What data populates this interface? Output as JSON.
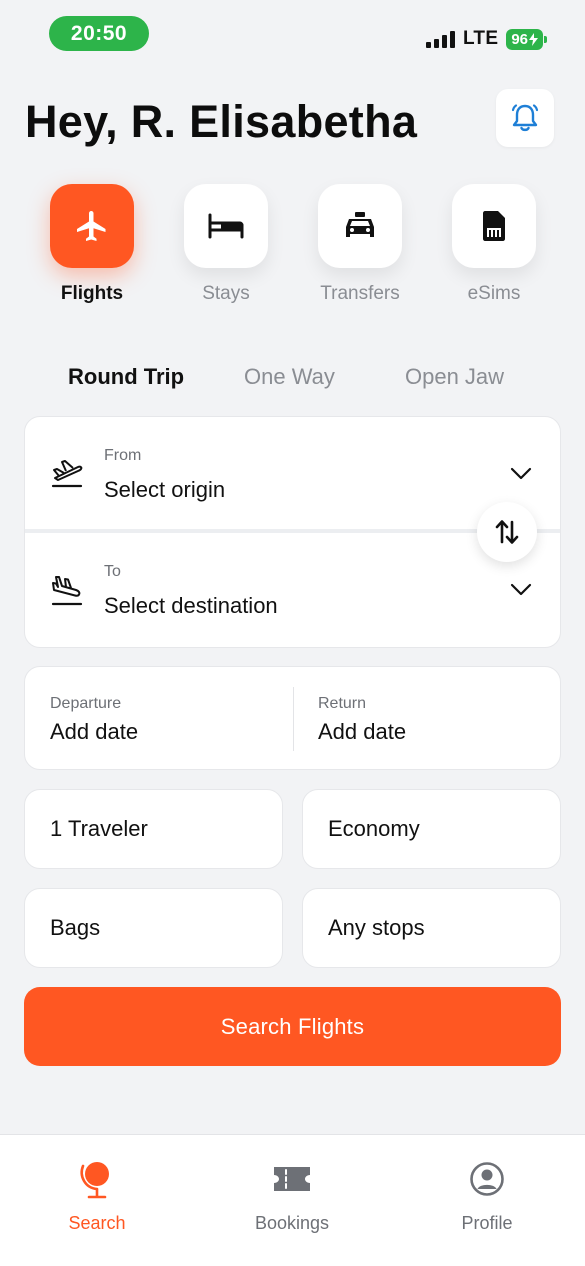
{
  "status_bar": {
    "time": "20:50",
    "network": "LTE",
    "battery": "96"
  },
  "header": {
    "greeting": "Hey, R. Elisabetha"
  },
  "categories": [
    {
      "label": "Flights",
      "icon": "airplane-icon",
      "active": true
    },
    {
      "label": "Stays",
      "icon": "bed-icon",
      "active": false
    },
    {
      "label": "Transfers",
      "icon": "taxi-icon",
      "active": false
    },
    {
      "label": "eSims",
      "icon": "sim-card-icon",
      "active": false
    }
  ],
  "trip_types": [
    {
      "label": "Round Trip",
      "active": true
    },
    {
      "label": "One Way",
      "active": false
    },
    {
      "label": "Open Jaw",
      "active": false
    }
  ],
  "route": {
    "from_label": "From",
    "from_value": "Select origin",
    "to_label": "To",
    "to_value": "Select destination"
  },
  "dates": {
    "departure_label": "Departure",
    "departure_value": "Add date",
    "return_label": "Return",
    "return_value": "Add date"
  },
  "options": {
    "travelers": "1 Traveler",
    "cabin": "Economy",
    "bags": "Bags",
    "stops": "Any stops"
  },
  "search_button": "Search Flights",
  "bottom_nav": [
    {
      "label": "Search",
      "icon": "globe-icon",
      "active": true
    },
    {
      "label": "Bookings",
      "icon": "ticket-icon",
      "active": false
    },
    {
      "label": "Profile",
      "icon": "profile-icon",
      "active": false
    }
  ],
  "colors": {
    "accent": "#ff5722",
    "status_green": "#2db44a",
    "background": "#f2f3f5"
  }
}
